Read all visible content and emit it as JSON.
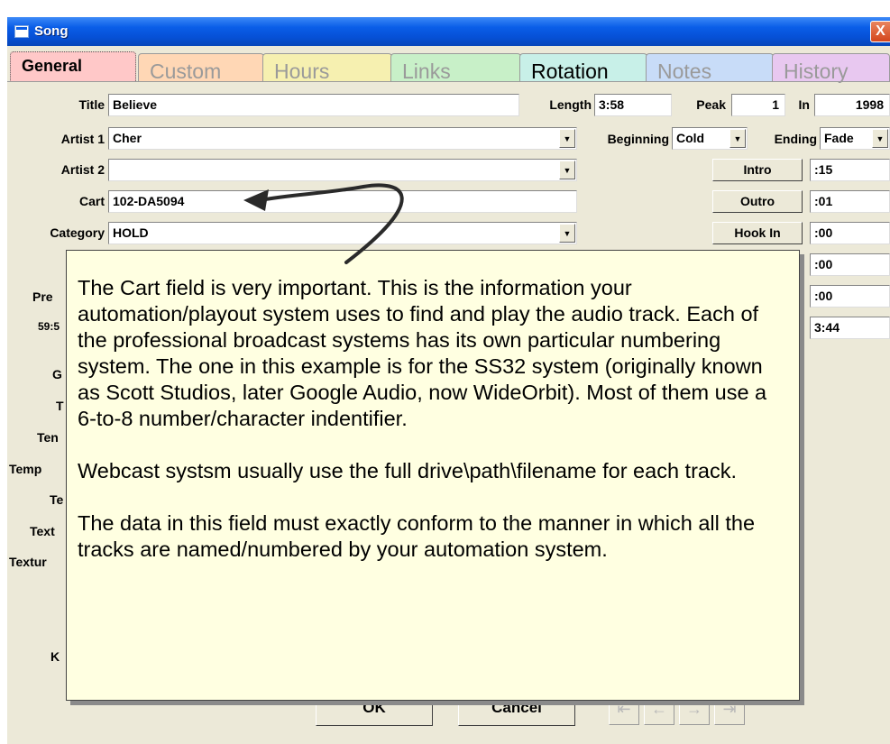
{
  "window": {
    "title": "Song",
    "close_glyph": "X"
  },
  "tabs": [
    {
      "label": "General",
      "color": "#ffc8c8"
    },
    {
      "label": "Custom",
      "color": "#ffd7b5"
    },
    {
      "label": "Hours",
      "color": "#f6f0b0"
    },
    {
      "label": "Links",
      "color": "#c8f0c8"
    },
    {
      "label": "Rotation",
      "color": "#c8f0e8"
    },
    {
      "label": "Notes",
      "color": "#c8dcf8"
    },
    {
      "label": "History",
      "color": "#e8c8f0"
    }
  ],
  "fields": {
    "title": {
      "label": "Title",
      "value": "Believe"
    },
    "artist1": {
      "label": "Artist 1",
      "value": "Cher"
    },
    "artist2": {
      "label": "Artist 2",
      "value": ""
    },
    "cart": {
      "label": "Cart",
      "value": "102-DA5094"
    },
    "category": {
      "label": "Category",
      "value": "HOLD"
    },
    "length": {
      "label": "Length",
      "value": "3:58"
    },
    "peak": {
      "label": "Peak",
      "value": "1"
    },
    "in": {
      "label": "In",
      "value": "1998"
    },
    "beginning": {
      "label": "Beginning",
      "value": "Cold"
    },
    "ending": {
      "label": "Ending",
      "value": "Fade"
    }
  },
  "timing": {
    "intro": {
      "button": "Intro",
      "value": ":15"
    },
    "outro": {
      "button": "Outro",
      "value": ":01"
    },
    "hook_in": {
      "button": "Hook In",
      "value": ":00"
    },
    "row4": {
      "value": ":00"
    },
    "row5": {
      "value": ":00"
    },
    "row6": {
      "value": "3:44"
    }
  },
  "hidden_labels": [
    "Pre",
    "59:5",
    "G",
    "T",
    "Ten",
    "Temp",
    "Te",
    "Text",
    "Textur",
    "",
    "K"
  ],
  "callout": {
    "paragraphs": [
      "The Cart field is very important.  This is the information your automation/playout system uses to find and play the audio track. Each of the professional broadcast systems has its own particular numbering system. The one in this example is for the SS32 system (originally known as Scott Studios, later Google Audio, now WideOrbit). Most of them use a 6-to-8 number/character indentifier.",
      "Webcast systsm usually use the full drive\\path\\filename for each track.",
      "The data in this field must exactly conform to the manner in which all the tracks are named/numbered by your automation system."
    ]
  },
  "buttons": {
    "ok": "OK",
    "cancel": "Cancel"
  },
  "nav_icons": [
    "first-icon",
    "prev-icon",
    "next-icon",
    "last-icon"
  ]
}
